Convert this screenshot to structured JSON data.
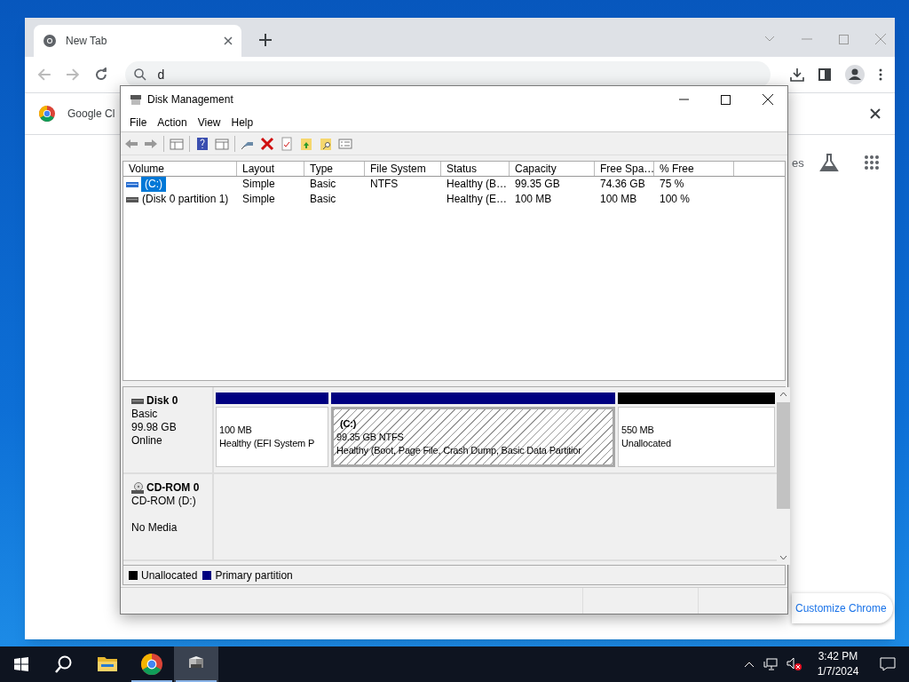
{
  "browser": {
    "tabs": [
      {
        "label": "New Tab",
        "selected": true
      }
    ],
    "address": {
      "value": "d"
    },
    "promo_text": "Google Cl",
    "page_text": "es",
    "customize_button": "Customize Chrome"
  },
  "disk_management": {
    "title": "Disk Management",
    "menu": [
      "File",
      "Action",
      "View",
      "Help"
    ],
    "columns": [
      "Volume",
      "Layout",
      "Type",
      "File System",
      "Status",
      "Capacity",
      "Free Spa…",
      "% Free"
    ],
    "rows": [
      {
        "selected": true,
        "volume": "(C:)",
        "layout": "Simple",
        "type": "Basic",
        "file_system": "NTFS",
        "status": "Healthy (B…",
        "capacity": "99.35 GB",
        "free_space": "74.36 GB",
        "percent_free": "75 %"
      },
      {
        "selected": false,
        "volume": "(Disk 0 partition 1)",
        "layout": "Simple",
        "type": "Basic",
        "status": "Healthy (E…",
        "capacity": "100 MB",
        "free_space": "100 MB",
        "percent_free": "100 %"
      }
    ],
    "disks": [
      {
        "kind": "disk",
        "name": "Disk 0",
        "type": "Basic",
        "size": "99.98 GB",
        "status": "Online",
        "partitions": [
          {
            "color": "#000080",
            "selected": false,
            "size": "100 MB",
            "status": "Healthy (EFI System P"
          },
          {
            "color": "#000080",
            "selected": true,
            "label": "(C:)",
            "size": "99.35 GB NTFS",
            "status": "Healthy (Boot, Page File, Crash Dump, Basic Data Partitior"
          },
          {
            "color": "#000000",
            "selected": false,
            "size": "550 MB",
            "status": "Unallocated"
          }
        ]
      },
      {
        "kind": "cdrom",
        "name": "CD-ROM 0",
        "type": "CD-ROM (D:)",
        "status": "No Media"
      }
    ],
    "legend": [
      {
        "label": "Unallocated",
        "color": "#000000"
      },
      {
        "label": "Primary partition",
        "color": "#000080"
      }
    ]
  },
  "taskbar": {
    "apps": [
      {
        "kind": "explorer",
        "running": false,
        "selected": false
      },
      {
        "kind": "chrome",
        "running": true,
        "selected": false
      },
      {
        "kind": "disk",
        "running": true,
        "selected": true
      }
    ],
    "time": "3:42 PM",
    "date": "1/7/2024"
  }
}
